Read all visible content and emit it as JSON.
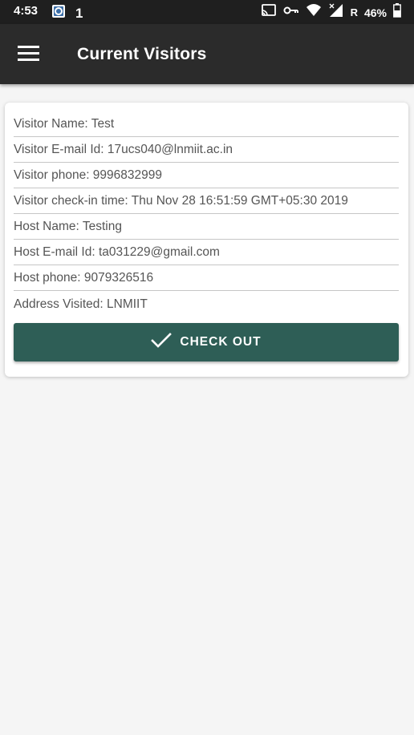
{
  "status_bar": {
    "time": "4:53",
    "carrier_indicator": "1",
    "network_label": "R",
    "battery": "46%",
    "icons": [
      "app-notification-icon",
      "cast-icon",
      "vpn-key-icon",
      "wifi-icon",
      "signal-icon",
      "battery-icon"
    ]
  },
  "app_bar": {
    "title": "Current Visitors",
    "menu_icon": "hamburger-menu-icon"
  },
  "visitor_card": {
    "fields": [
      "Visitor Name: Test",
      "Visitor E-mail Id: 17ucs040@lnmiit.ac.in",
      "Visitor phone: 9996832999",
      "Visitor check-in time: Thu Nov 28 16:51:59 GMT+05:30 2019",
      "Host Name: Testing",
      "Host E-mail Id: ta031229@gmail.com",
      "Host phone: 9079326516",
      "Address Visited: LNMIIT"
    ],
    "checkout_label": "CHECK OUT",
    "checkout_icon": "check-icon"
  },
  "colors": {
    "app_bar": "#2b2b2b",
    "status_bar": "#1f1f1f",
    "button": "#2e5e56",
    "background": "#f5f5f5"
  }
}
